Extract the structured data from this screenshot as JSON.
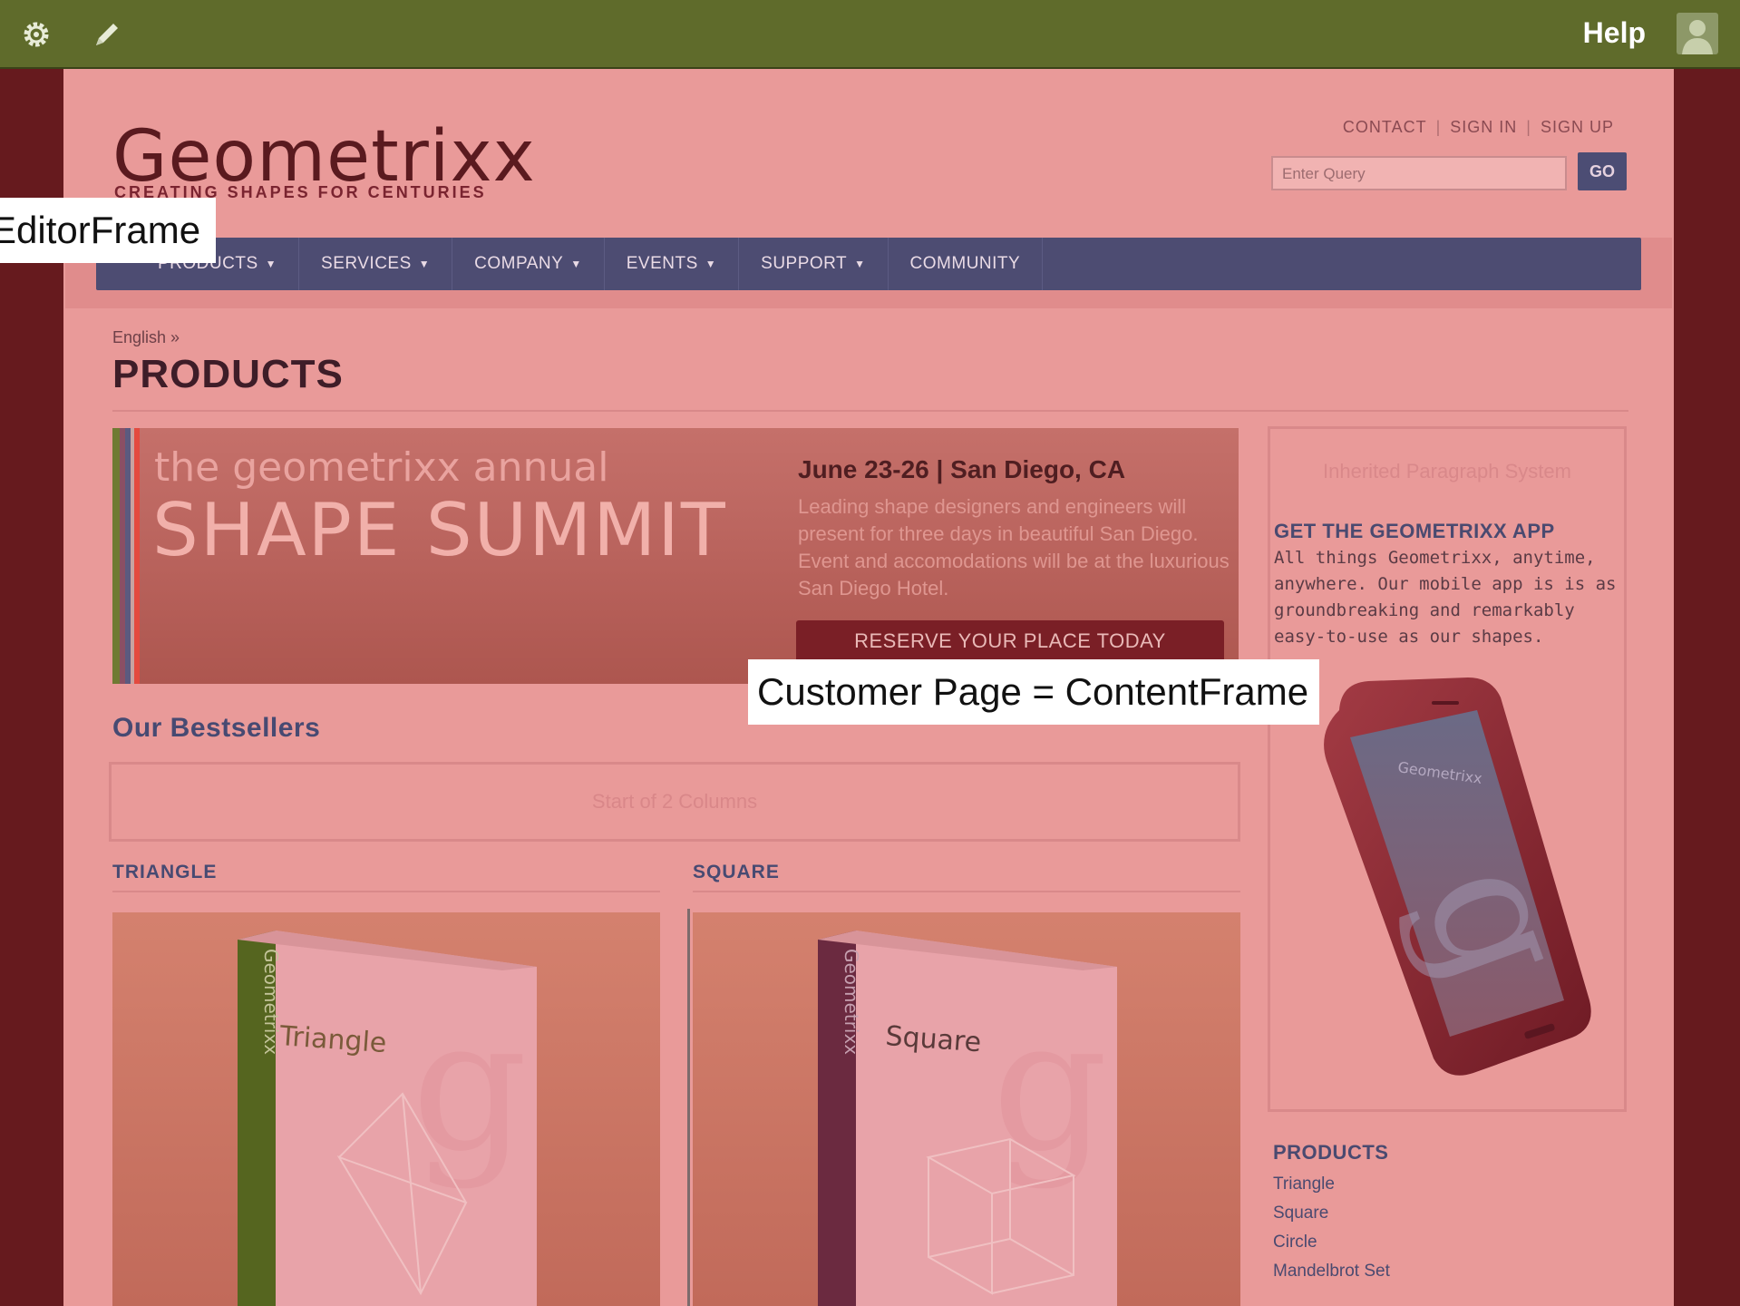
{
  "toolbar": {
    "settings_icon": "gear-icon",
    "edit_icon": "pencil-icon",
    "help_label": "Help",
    "user_icon": "user-avatar-icon"
  },
  "site": {
    "logo": "Geometrixx",
    "tagline": "CREATING SHAPES FOR CENTURIES",
    "util_links": [
      "CONTACT",
      "SIGN IN",
      "SIGN UP"
    ],
    "search_placeholder": "Enter Query",
    "go_label": "GO",
    "nav": [
      {
        "label": "PRODUCTS",
        "dropdown": true
      },
      {
        "label": "SERVICES",
        "dropdown": true
      },
      {
        "label": "COMPANY",
        "dropdown": true
      },
      {
        "label": "EVENTS",
        "dropdown": true
      },
      {
        "label": "SUPPORT",
        "dropdown": true
      },
      {
        "label": "COMMUNITY",
        "dropdown": false
      }
    ]
  },
  "page": {
    "breadcrumb": "English »",
    "title": "PRODUCTS"
  },
  "banner": {
    "small": "the geometrixx annual",
    "big": "SHAPE SUMMIT",
    "date": "June 23-26  |  San Diego, CA",
    "description": "Leading shape designers and engineers will present for three days in beautiful San Diego. Event and accomodations will be at the luxurious San Diego Hotel.",
    "cta": "RESERVE YOUR PLACE TODAY"
  },
  "sidebar": {
    "inherited": "Inherited Paragraph System",
    "app_title": "GET THE GEOMETRIXX APP",
    "app_desc": "All things Geometrixx, anytime, anywhere. Our mobile app is is as groundbreaking and remarkably easy-to-use as our shapes.",
    "products_header": "PRODUCTS",
    "products": [
      "Triangle",
      "Square",
      "Circle",
      "Mandelbrot Set"
    ]
  },
  "bestsellers": {
    "title": "Our Bestsellers",
    "columns_placeholder": "Start of 2 Columns",
    "col1": {
      "header": "TRIANGLE",
      "box_label": "Triangle"
    },
    "col2": {
      "header": "SQUARE",
      "box_label": "Square"
    },
    "brand_spine": "Geometrixx"
  },
  "overlays": {
    "editor_frame": "EditorFrame",
    "content_frame": "Customer Page = ContentFrame"
  },
  "colors": {
    "toolbar": "#5f6b2b",
    "editor_frame": "#661a1e",
    "content_overlay": "#e99a99",
    "nav": "#4d4c72"
  }
}
